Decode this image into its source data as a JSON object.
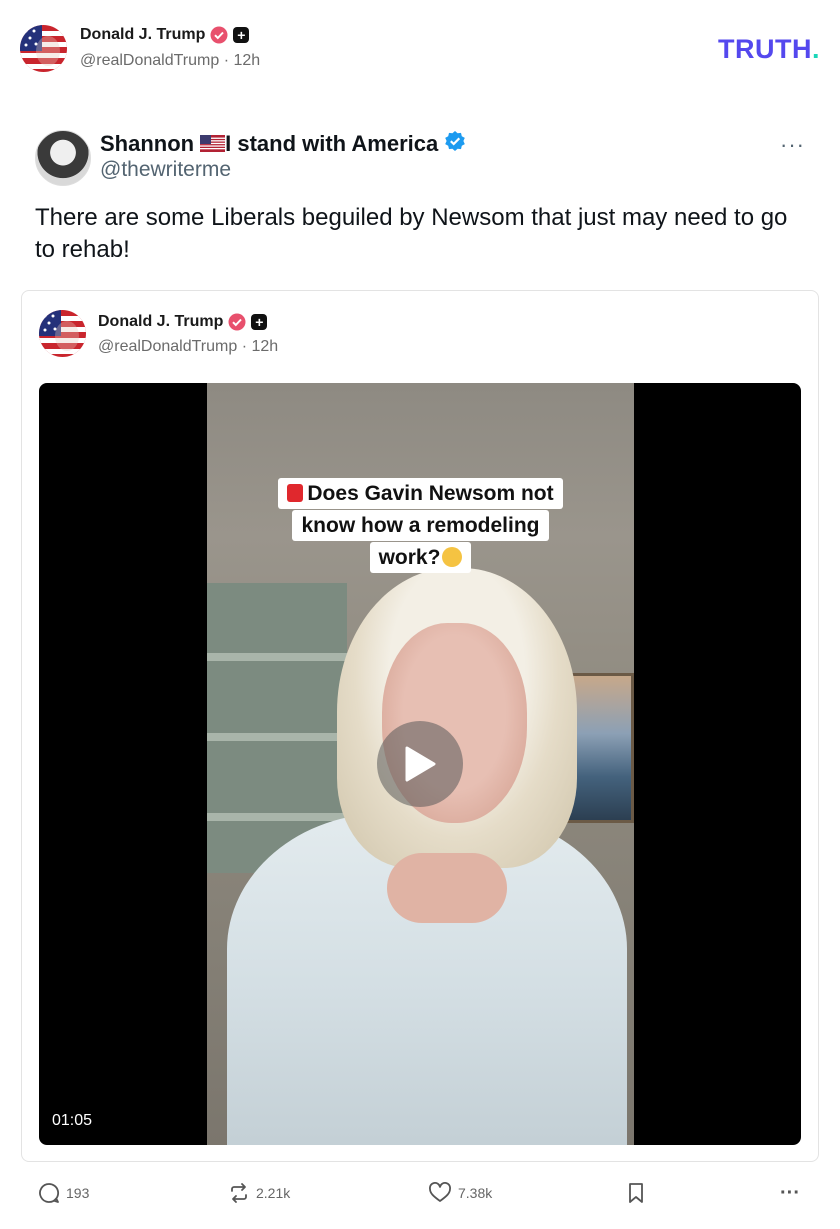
{
  "header": {
    "name": "Donald J. Trump",
    "handle": "@realDonaldTrump",
    "time": "· 12h",
    "brand_main": "TRUTH",
    "brand_dot": ".",
    "brand_color": "#5448ee",
    "brand_dot_color": "#1ad6b8"
  },
  "tweet": {
    "name": "Shannon",
    "name_suffix": "I stand with America",
    "handle": "@thewriterme",
    "more": "···",
    "text": "There are some Liberals beguiled by Newsom that just may need to go to rehab!"
  },
  "card": {
    "name": "Donald J. Trump",
    "handle": "@realDonaldTrump",
    "time": "· 12h",
    "video": {
      "caption_line1": "Does Gavin Newsom not",
      "caption_line2": "know how a remodeling",
      "caption_line3": "work?",
      "duration": "01:05"
    }
  },
  "actions": {
    "replies": "193",
    "retruths": "2.21k",
    "likes": "7.38k",
    "more": "···"
  },
  "icons": {
    "verified_pink": "verified-badge-icon",
    "plus": "plus-badge-icon",
    "verified_blue": "verified-check-icon",
    "reply": "comment-icon",
    "retruth": "repost-icon",
    "like": "heart-icon",
    "bookmark": "bookmark-icon",
    "play": "play-icon"
  }
}
